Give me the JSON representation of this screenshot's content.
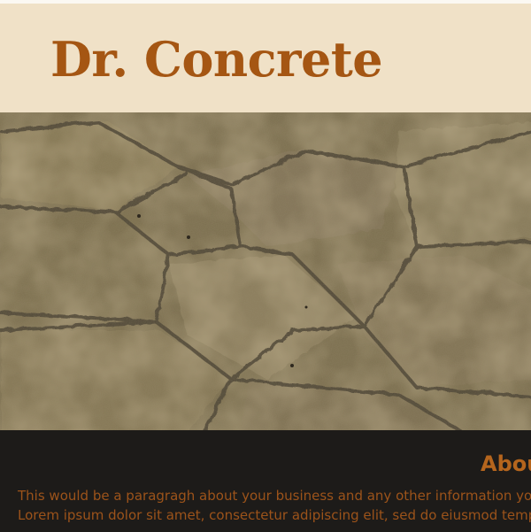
{
  "header": {
    "brand_title": "Dr. Concrete"
  },
  "hero": {
    "image": "stamped-concrete-flagstone-texture"
  },
  "about": {
    "heading": "About",
    "paragraph_line_1": "This would be a paragragh about your business and any other information you wo",
    "paragraph_line_2": "Lorem ipsum dolor sit amet, consectetur adipiscing elit, sed do eiusmod tempor in"
  },
  "colors": {
    "header_bg": "#f0e1c7",
    "brand": "#a55613",
    "about_bg": "#1d1b19",
    "about_text": "#9c531a"
  }
}
